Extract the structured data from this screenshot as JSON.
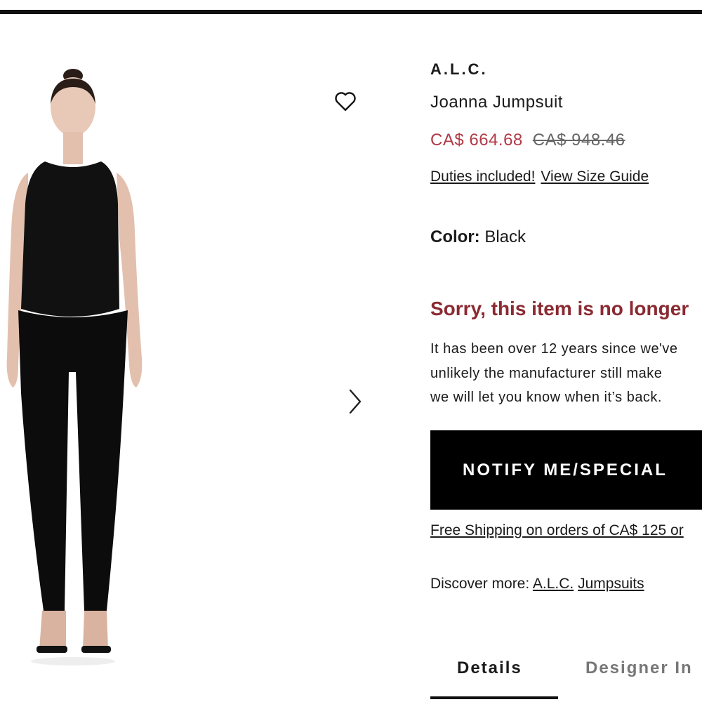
{
  "product": {
    "brand": "A.L.C.",
    "name": "Joanna Jumpsuit",
    "price_sale": "CA$ 664.68",
    "price_original": "CA$ 948.46",
    "duties_link": "Duties included!",
    "size_guide_link": "View Size Guide",
    "color_label": "Color:",
    "color_value": "Black"
  },
  "availability": {
    "heading": "Sorry, this item is no longer",
    "message_lines": [
      "It has been over 12 years since we've",
      "unlikely the manufacturer still make",
      "we will let you know when it’s back."
    ],
    "notify_button": "NOTIFY ME/SPECIAL"
  },
  "shipping_text": "Free Shipping on orders of CA$ 125 or",
  "discover": {
    "label": "Discover more:",
    "links": [
      "A.L.C.",
      "Jumpsuits"
    ]
  },
  "tabs": [
    "Details",
    "Designer In"
  ],
  "icons": {
    "wishlist": "heart-outline-icon",
    "next_image": "chevron-right-icon"
  },
  "colors": {
    "sale_price": "#b23a48",
    "unavailable_heading": "#8a2a32",
    "button_bg": "#000000"
  }
}
